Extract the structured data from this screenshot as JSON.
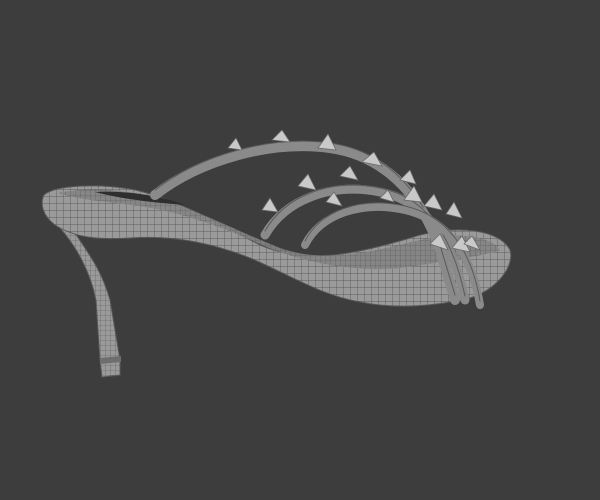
{
  "scene": {
    "subject_icon": "stiletto-mule-sandal-wireframe",
    "background_color": "#3d3d3d",
    "mesh_fill_color": "#9a9a9a",
    "mesh_dark_color": "#6e6e6e",
    "wire_color": "#4a4a4a",
    "stud_color": "#c9c9c9"
  }
}
